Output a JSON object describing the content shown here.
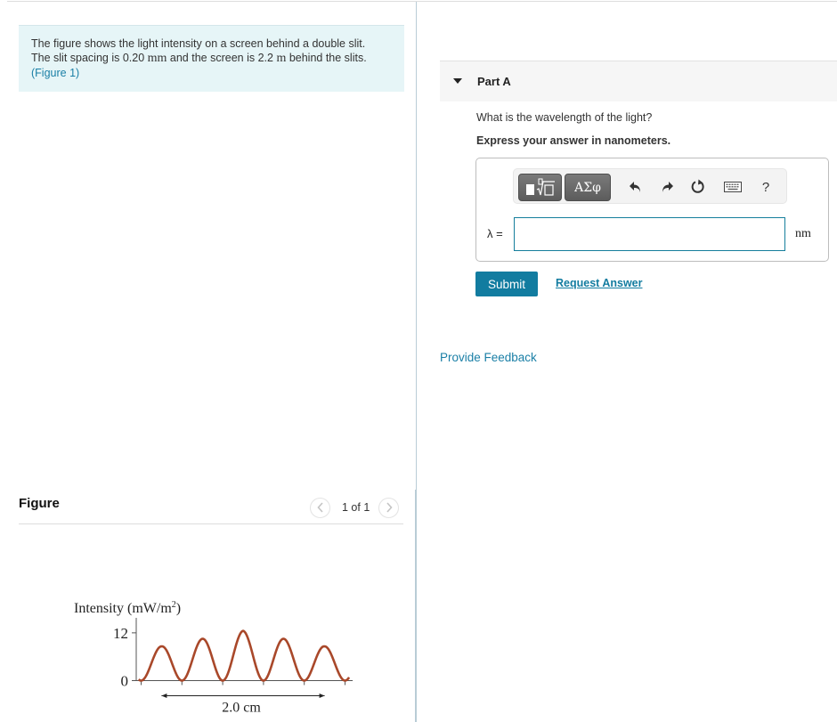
{
  "problem": {
    "line1": "The figure shows the light intensity on a screen behind a double slit.",
    "line2_a": "The slit spacing is 0.20",
    "line2_unit1": "mm",
    "line2_b": "and the screen is 2.2",
    "line2_unit2": "m",
    "line2_c": "behind the slits.",
    "figure_link": "(Figure 1)"
  },
  "figure": {
    "title": "Figure",
    "pager": "1 of 1",
    "prev_icon": "chevron-left-icon",
    "next_icon": "chevron-right-icon"
  },
  "part": {
    "title": "Part A",
    "question": "What is the wavelength of the light?",
    "instruction": "Express your answer in nanometers.",
    "toolbar": {
      "templates_icon": "templates-sqrt-icon",
      "symbols_label": "ΑΣφ",
      "undo_icon": "undo-icon",
      "redo_icon": "redo-icon",
      "reset_icon": "reset-icon",
      "keyboard_icon": "keyboard-icon",
      "help_label": "?"
    },
    "answer_label": "λ =",
    "answer_value": "",
    "answer_unit": "nm",
    "submit_label": "Submit",
    "request_label": "Request Answer"
  },
  "feedback_label": "Provide Feedback",
  "colors": {
    "accent": "#127ca0",
    "link": "#1a7fa6",
    "intro_bg": "#e6f5f7",
    "curve": "#a9482a"
  },
  "chart_data": {
    "type": "line",
    "title": "",
    "ylabel": "Intensity (mW/m²)",
    "xlabel": "",
    "y_ticks": [
      0,
      12
    ],
    "ylim": [
      0,
      14
    ],
    "x_unit": "cm",
    "fringe_spacing_cm": 0.5,
    "minima_x_cm": [
      -1.25,
      -0.75,
      -0.25,
      0.25,
      0.75,
      1.25
    ],
    "peaks": [
      {
        "x": -1.0,
        "y": 8.6
      },
      {
        "x": -0.5,
        "y": 10.5
      },
      {
        "x": 0.0,
        "y": 12.5
      },
      {
        "x": 0.5,
        "y": 10.5
      },
      {
        "x": 1.0,
        "y": 8.6
      }
    ],
    "xlim": [
      -1.3,
      1.3
    ],
    "annotation": {
      "text": "2.0 cm",
      "from_x": -1.0,
      "to_x": 1.0
    },
    "grid": false
  }
}
